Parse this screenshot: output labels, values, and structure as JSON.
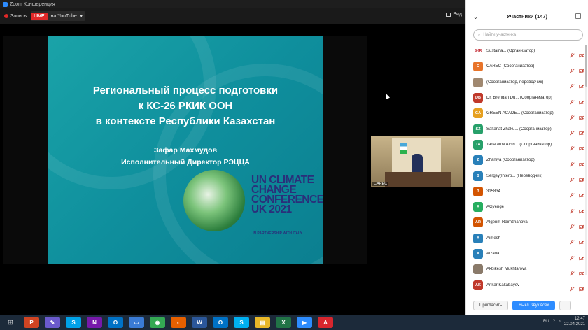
{
  "window": {
    "title": "Zoom Конференция"
  },
  "toolbar": {
    "record_label": "Запись",
    "live_badge": "LIVE",
    "live_target": "на YouTube",
    "view_label": "Вид"
  },
  "slide": {
    "title_lines": [
      "Региональный процесс подготовки",
      "к КС-26 РКИК ООН",
      "в контексте Республики Казахстан"
    ],
    "author_name": "Зафар Махмудов",
    "author_role": "Исполнительный Директор РЭЦЦА",
    "logo_lines": [
      "UN CLIMATE",
      "CHANGE",
      "CONFERENCE",
      "UK 2021"
    ],
    "partner_text": "IN PARTNERSHIP WITH ITALY"
  },
  "video_thumb": {
    "label": "CAREC"
  },
  "participants": {
    "title": "Участники (147)",
    "search_placeholder": "Найти участника",
    "rows": [
      {
        "initials": "SKR",
        "name": "Sustaina... (Организатор)",
        "color": "#ffffff",
        "text_color": "#c0202a"
      },
      {
        "initials": "C",
        "name": "CAREC (Соорганизатор)",
        "color": "#e8742a"
      },
      {
        "initials": "",
        "name": "(Соорганизатор, переводчик)",
        "color": "#a08870"
      },
      {
        "initials": "DB",
        "name": "Dr. Brendan Du... (Соорганизатор)",
        "color": "#c0392b"
      },
      {
        "initials": "GA",
        "name": "GREEN ACADE... (Соорганизатор)",
        "color": "#e6a020"
      },
      {
        "initials": "SZ",
        "name": "Saltanat Zhaku... (Соорганизатор)",
        "color": "#27a06a"
      },
      {
        "initials": "TA",
        "name": "Tanatarov Alish... (Соорганизатор)",
        "color": "#27a06a"
      },
      {
        "initials": "Z",
        "name": "Zhaniya (Соорганизатор)",
        "color": "#2980b9"
      },
      {
        "initials": "S",
        "name": "Sergey(Interp... (Переводчик)",
        "color": "#2980b9"
      },
      {
        "initials": "3",
        "name": "315834",
        "color": "#d35400"
      },
      {
        "initials": "A",
        "name": "AGyenge",
        "color": "#27ae60"
      },
      {
        "initials": "AR",
        "name": "Algerim Raimzhanova",
        "color": "#d35400"
      },
      {
        "initials": "A",
        "name": "Aimesh",
        "color": "#2980b9"
      },
      {
        "initials": "A",
        "name": "Aizada",
        "color": "#2980b9"
      },
      {
        "initials": "",
        "name": "Akbikesh Mukhtarova",
        "color": "#8a7a6a"
      },
      {
        "initials": "AK",
        "name": "Ankar Kakabayev",
        "color": "#c0392b"
      }
    ],
    "footer": {
      "invite": "Пригласить",
      "mute_all": "Выкл. звук всех",
      "more": "..."
    }
  },
  "taskbar": {
    "lang": "RU",
    "time": "12:47",
    "date": "22.04.2021",
    "apps": [
      {
        "icon": "powerpoint-icon",
        "glyph": "P",
        "color": "#d04423"
      },
      {
        "icon": "paint-icon",
        "glyph": "✎",
        "color": "#6a5acd"
      },
      {
        "icon": "skype-icon",
        "glyph": "S",
        "color": "#00a2e8"
      },
      {
        "icon": "onenote-icon",
        "glyph": "N",
        "color": "#7719aa"
      },
      {
        "icon": "outlook-icon",
        "glyph": "O",
        "color": "#0072c6"
      },
      {
        "icon": "screen-icon",
        "glyph": "▭",
        "color": "#3a7bd5"
      },
      {
        "icon": "chrome-icon",
        "glyph": "◉",
        "color": "#34a853"
      },
      {
        "icon": "firefox-icon",
        "glyph": "◐",
        "color": "#e66000"
      },
      {
        "icon": "word-icon",
        "glyph": "W",
        "color": "#2b579a"
      },
      {
        "icon": "outlook2-icon",
        "glyph": "O",
        "color": "#0072c6"
      },
      {
        "icon": "skype2-icon",
        "glyph": "S",
        "color": "#00aff0"
      },
      {
        "icon": "explorer-icon",
        "glyph": "▤",
        "color": "#e8b828"
      },
      {
        "icon": "excel-icon",
        "glyph": "X",
        "color": "#217346"
      },
      {
        "icon": "zoom-icon",
        "glyph": "▶",
        "color": "#2d8cff"
      },
      {
        "icon": "acrobat-icon",
        "glyph": "A",
        "color": "#d7262e"
      }
    ]
  }
}
